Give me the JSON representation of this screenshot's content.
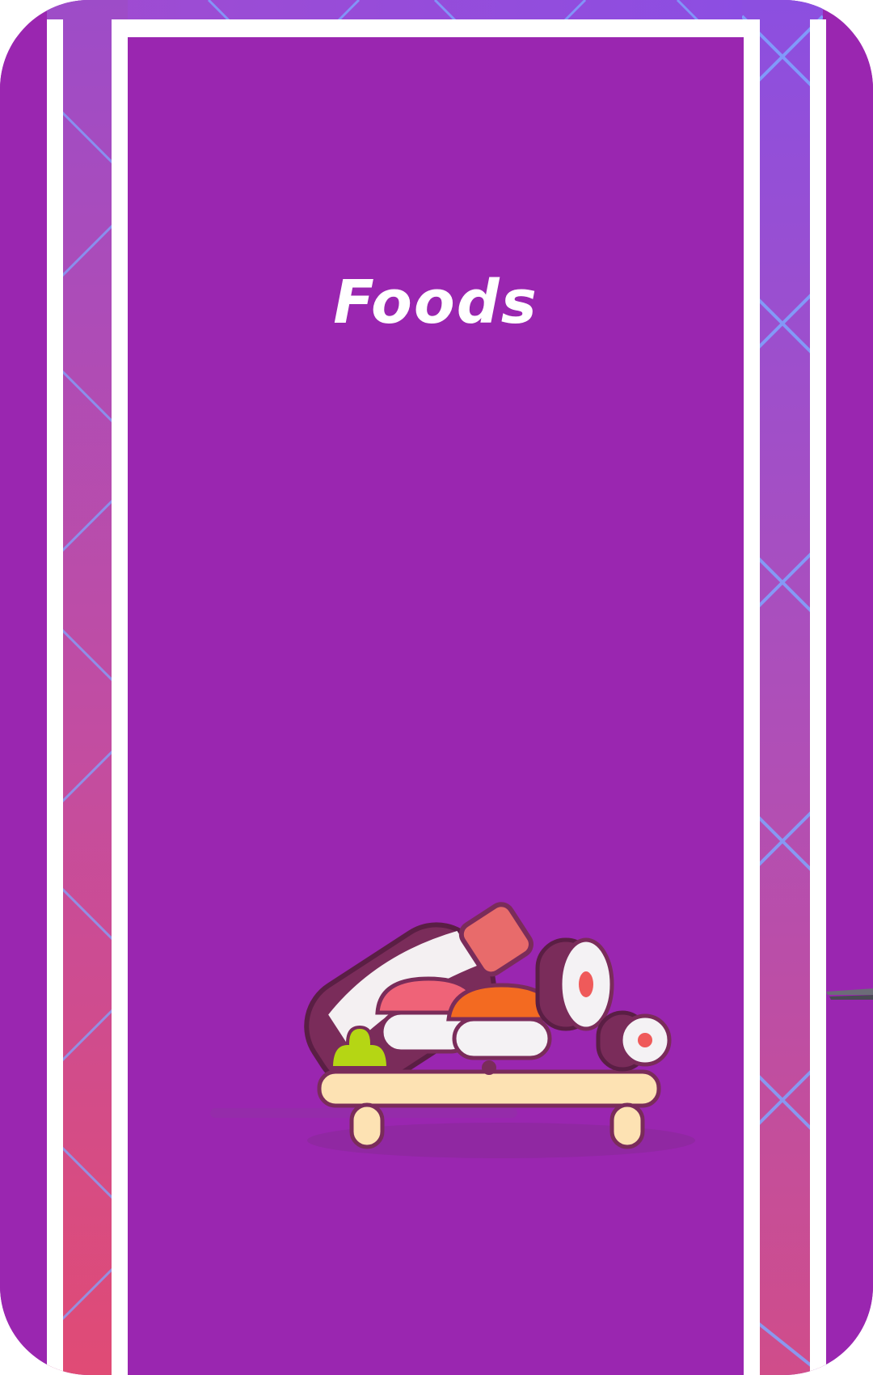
{
  "screen": {
    "title": "Foods",
    "illustration": "sushi-icon"
  },
  "colors": {
    "card_background": "#9a26b0",
    "frame": "#ffffff",
    "side_gradient_top": "#9d4cc8",
    "side_gradient_bottom": "#e04b75",
    "grid_lines": "#7fa6ff",
    "title_text": "#ffffff"
  }
}
